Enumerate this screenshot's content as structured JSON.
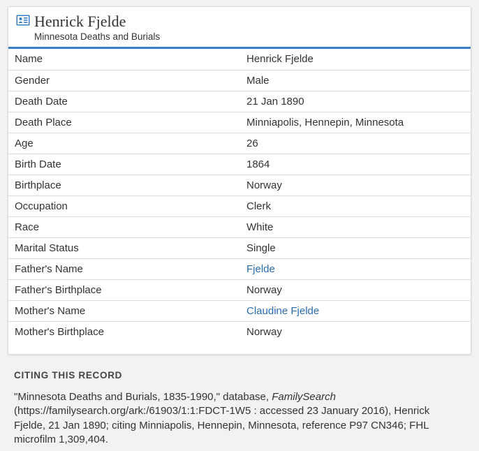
{
  "record": {
    "icon": "record-card-icon",
    "title": "Henrick Fjelde",
    "collection": "Minnesota Deaths and Burials"
  },
  "facts": [
    {
      "label": "Name",
      "value": "Henrick Fjelde",
      "link": false
    },
    {
      "label": "Gender",
      "value": "Male",
      "link": false
    },
    {
      "label": "Death Date",
      "value": "21 Jan 1890",
      "link": false
    },
    {
      "label": "Death Place",
      "value": "Minniapolis, Hennepin, Minnesota",
      "link": false
    },
    {
      "label": "Age",
      "value": "26",
      "link": false
    },
    {
      "label": "Birth Date",
      "value": "1864",
      "link": false
    },
    {
      "label": "Birthplace",
      "value": "Norway",
      "link": false
    },
    {
      "label": "Occupation",
      "value": "Clerk",
      "link": false
    },
    {
      "label": "Race",
      "value": "White",
      "link": false
    },
    {
      "label": "Marital Status",
      "value": "Single",
      "link": false
    },
    {
      "label": "Father's Name",
      "value": "Fjelde",
      "link": true
    },
    {
      "label": "Father's Birthplace",
      "value": "Norway",
      "link": false
    },
    {
      "label": "Mother's Name",
      "value": "Claudine Fjelde",
      "link": true
    },
    {
      "label": "Mother's Birthplace",
      "value": "Norway",
      "link": false
    }
  ],
  "citation": {
    "heading": "CITING THIS RECORD",
    "text_before": "\"Minnesota Deaths and Burials, 1835-1990,\" database, ",
    "source_name": "FamilySearch",
    "text_after": " (https://familysearch.org/ark:/61903/1:1:FDCT-1W5 : accessed 23 January 2016), Henrick Fjelde, 21 Jan 1890; citing Minniapolis, Hennepin, Minnesota, reference P97 CN346; FHL microfilm 1,309,404."
  },
  "colors": {
    "accent": "#3a7fc2",
    "link": "#2b6cb0",
    "text": "#333333",
    "background": "#f2f2f2"
  }
}
